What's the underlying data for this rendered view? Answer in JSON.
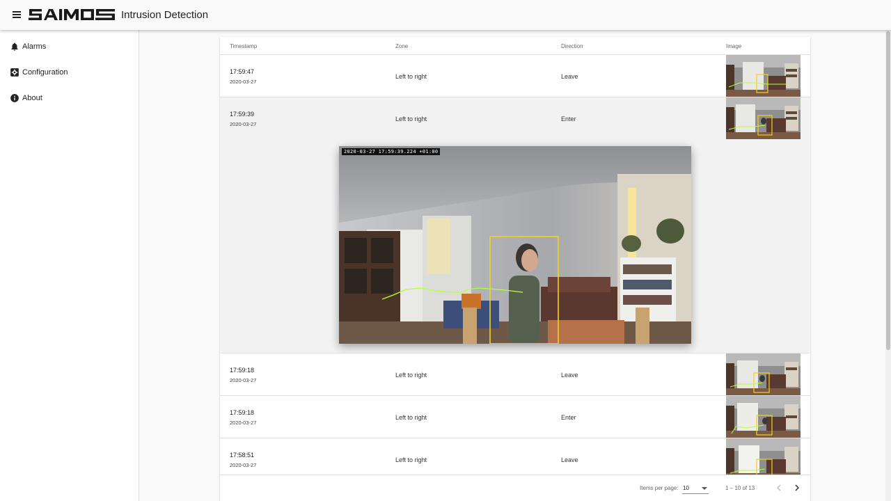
{
  "app": {
    "logo_text": "SAIMOS",
    "title": "Intrusion Detection"
  },
  "sidebar": {
    "items": [
      {
        "label": "Alarms",
        "icon": "bell-icon"
      },
      {
        "label": "Configuration",
        "icon": "settings-box-icon"
      },
      {
        "label": "About",
        "icon": "info-icon"
      }
    ]
  },
  "table": {
    "columns": [
      "Timestamp",
      "Zone",
      "Direction",
      "Image"
    ],
    "rows": [
      {
        "time": "17:59:47",
        "date": "2020-03-27",
        "zone": "Left to right",
        "direction": "Leave"
      },
      {
        "time": "17:59:39",
        "date": "2020-03-27",
        "zone": "Left to right",
        "direction": "Enter"
      },
      {
        "time": "17:59:18",
        "date": "2020-03-27",
        "zone": "Left to right",
        "direction": "Leave"
      },
      {
        "time": "17:59:18",
        "date": "2020-03-27",
        "zone": "Left to right",
        "direction": "Enter"
      },
      {
        "time": "17:58:51",
        "date": "2020-03-27",
        "zone": "Left to right",
        "direction": "Leave"
      }
    ],
    "expanded_image_timestamp": "2020-03-27 17:59:39.224 +01:00"
  },
  "paginator": {
    "items_per_page_label": "Items per page:",
    "items_per_page": "10",
    "range": "1 – 10 of 13"
  },
  "colors": {
    "detection_box": "#f2d21b",
    "track_line": "#b6ff3a"
  }
}
